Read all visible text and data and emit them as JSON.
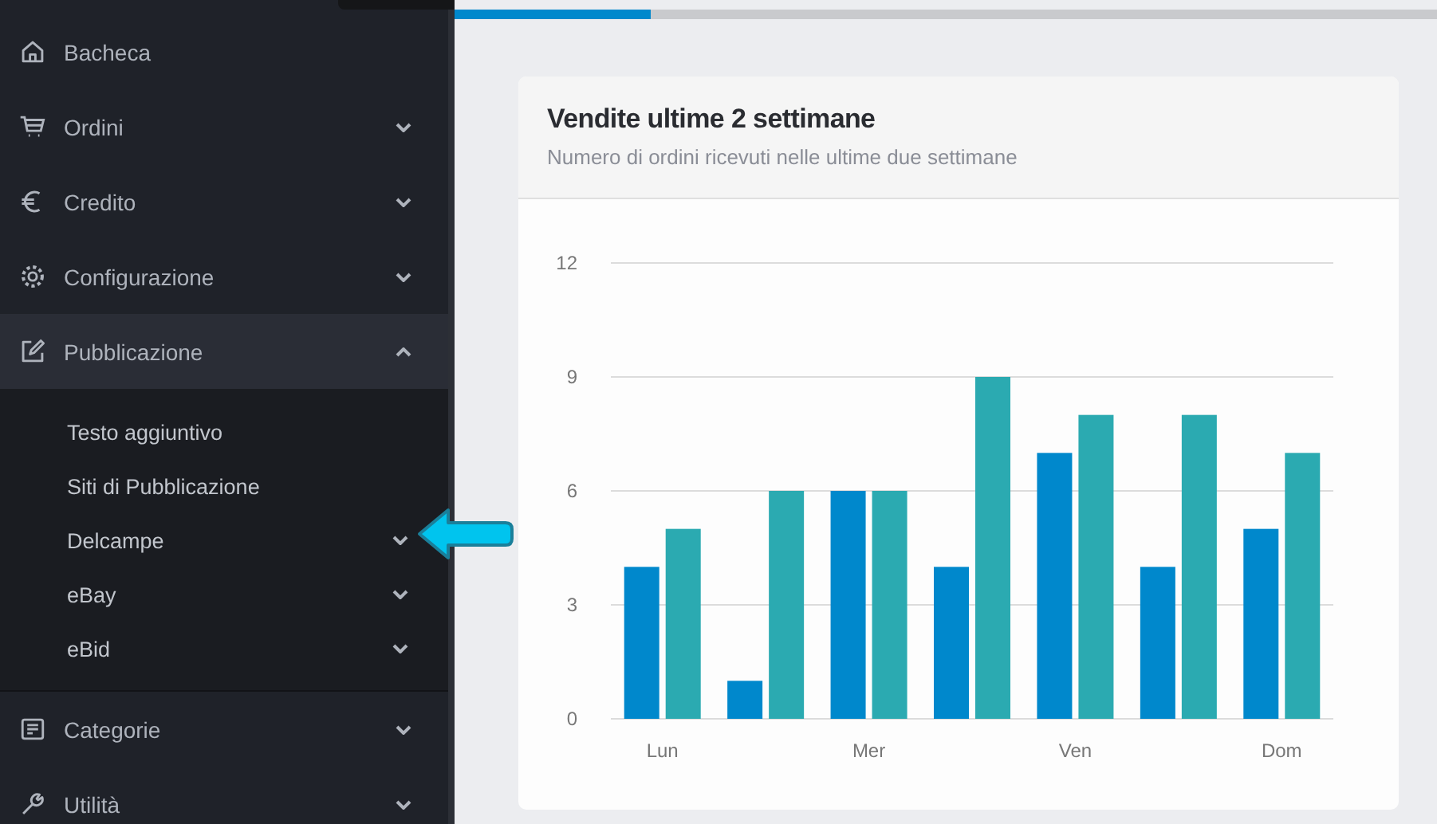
{
  "top_bar": {
    "loading": {
      "level": 0.2
    }
  },
  "sidebar": {
    "items": [
      {
        "label": "Bacheca",
        "kind": "link",
        "selected": false
      },
      {
        "label": "Ordini",
        "kind": "menu",
        "selected": false,
        "expanded": false
      },
      {
        "label": "Credito",
        "kind": "menu",
        "selected": false,
        "expanded": false
      },
      {
        "label": "Configurazione",
        "kind": "menu",
        "selected": false,
        "expanded": false
      },
      {
        "label": "Pubblicazione",
        "kind": "menu",
        "selected": true,
        "expanded": true,
        "children": [
          {
            "label": "Testo aggiuntivo",
            "kind": "link"
          },
          {
            "label": "Siti di Pubblicazione",
            "kind": "link"
          },
          {
            "label": "Delcampe",
            "kind": "menu",
            "expanded": false
          },
          {
            "label": "eBay",
            "kind": "menu",
            "expanded": false
          },
          {
            "label": "eBid",
            "kind": "menu",
            "expanded": false
          }
        ]
      },
      {
        "label": "Categorie",
        "kind": "menu",
        "selected": false,
        "expanded": false
      },
      {
        "label": "Utilità",
        "kind": "menu",
        "selected": false,
        "expanded": false
      }
    ]
  },
  "card": {
    "title": "Vendite ultime 2 settimane",
    "subtitle": "Numero di ordini ricevuti nelle ultime due settimane",
    "chart_data": {
      "type": "bar",
      "categories": [
        "Lun",
        null,
        "Mer",
        null,
        "Ven",
        null,
        "Dom"
      ],
      "series": [
        {
          "color": "#0088cc",
          "values": [
            4,
            1,
            6,
            4,
            7,
            4,
            5
          ]
        },
        {
          "color": "#2baab1",
          "values": [
            5,
            6,
            6,
            9,
            8,
            8,
            7
          ]
        }
      ],
      "ylim": [
        0,
        12
      ],
      "yticks": [
        0,
        3,
        6,
        9,
        12
      ],
      "grid": true
    }
  }
}
